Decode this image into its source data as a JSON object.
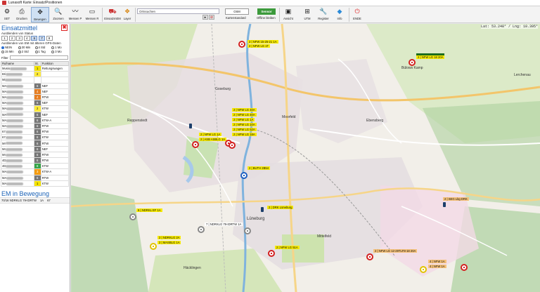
{
  "window": {
    "title": "Lunasoft Karte: Einsatz/Positionen"
  },
  "ribbon": {
    "buttons": [
      {
        "label": "SET",
        "icon": "gear-icon"
      },
      {
        "label": "Drucken",
        "icon": "printer-icon"
      },
      {
        "label": "Bewegen",
        "icon": "move-icon"
      },
      {
        "label": "Zoomen",
        "icon": "zoom-icon"
      },
      {
        "label": "Messen P",
        "icon": "measure-line-icon"
      },
      {
        "label": "Messen R",
        "icon": "measure-area-icon"
      },
      {
        "label": "EinsatzmEM",
        "icon": "units-icon"
      },
      {
        "label": "Layer",
        "icon": "layers-icon"
      },
      {
        "label": "Kartenstandard",
        "icon": "map-icon"
      },
      {
        "label": "Offline bleiben",
        "icon": "offline-icon"
      },
      {
        "label": "Ansicht",
        "icon": "monitor-icon"
      },
      {
        "label": "UTM",
        "icon": "grid-icon"
      },
      {
        "label": "Register",
        "icon": "wrench-icon"
      },
      {
        "label": "Info",
        "icon": "info-icon"
      },
      {
        "label": "ENDE",
        "icon": "power-icon"
      }
    ],
    "search_value": "Ortssuchen",
    "search_reset": "Rücksetzen",
    "map_source": "OSM",
    "sensor_label": "Sensor"
  },
  "left": {
    "title": "Einsatzmittel",
    "status_label": "Ausblenden von Status",
    "status_boxes": [
      "1",
      "2",
      "3",
      "4",
      "6",
      "7",
      "8"
    ],
    "gps_label": "Ausblenden von EM mit älteren GPS-Daten",
    "gps_options": [
      "NEIN",
      "30 Min",
      "4 Std",
      "1 Mo",
      "15 Min",
      "2 Std",
      "1 Tag",
      "3 Mo"
    ],
    "filter_label": "Filter",
    "table_headers": [
      "Rufname",
      "St.",
      "Funktion"
    ],
    "units": [
      {
        "name": "Musio",
        "st": "1",
        "fn": "Rettungswagen",
        "cls": "st-1"
      },
      {
        "name": "Bri",
        "st": "2",
        "fn": "",
        "cls": "st-2"
      },
      {
        "name": "Mi",
        "st": "",
        "fn": "",
        "cls": ""
      },
      {
        "name": "MA",
        "st": "6",
        "fn": "NEF",
        "cls": "st-6"
      },
      {
        "name": "MA",
        "st": "4",
        "fn": "NEF",
        "cls": "st-4"
      },
      {
        "name": "MA",
        "st": "4",
        "fn": "RTW",
        "cls": "st-4"
      },
      {
        "name": "MA",
        "st": "6",
        "fn": "NEF",
        "cls": "st-6"
      },
      {
        "name": "MA",
        "st": "2",
        "fn": "KTW",
        "cls": "st-2"
      },
      {
        "name": "MA",
        "st": "6",
        "fn": "NEF",
        "cls": "st-6"
      },
      {
        "name": "MA",
        "st": "6",
        "fn": "KTW-A",
        "cls": "st-6"
      },
      {
        "name": "MA",
        "st": "6",
        "fn": "RTW",
        "cls": "st-6"
      },
      {
        "name": "67",
        "st": "6",
        "fn": "RTW",
        "cls": "st-6"
      },
      {
        "name": "67",
        "st": "6",
        "fn": "KTW",
        "cls": "st-6"
      },
      {
        "name": "MI",
        "st": "6",
        "fn": "RTW",
        "cls": "st-6"
      },
      {
        "name": "MI",
        "st": "6",
        "fn": "NEF",
        "cls": "st-6"
      },
      {
        "name": "MI",
        "st": "6",
        "fn": "RTW",
        "cls": "st-6"
      },
      {
        "name": "4D",
        "st": "6",
        "fn": "RTW",
        "cls": "st-6"
      },
      {
        "name": "4D",
        "st": "8",
        "fn": "KTW",
        "cls": "st-8"
      },
      {
        "name": "MA",
        "st": "3",
        "fn": "KTW-A",
        "cls": "st-3"
      },
      {
        "name": "MA",
        "st": "6",
        "fn": "RTW",
        "cls": "st-6"
      },
      {
        "name": "MA",
        "st": "1",
        "fn": "KTW",
        "cls": "st-1"
      }
    ],
    "em_title": "EM in Bewegung",
    "em_row": {
      "name": "70/16 NDRKLG 79-IDRTW",
      "a": "1A",
      "b": "67"
    }
  },
  "map": {
    "coords": "Lat: 53.248° / Lng: 10.395°",
    "labels": [
      {
        "text": "2 | NFW 15-25-21 1A",
        "cls": ""
      },
      {
        "text": "2 | NFW LG 1T",
        "cls": ""
      },
      {
        "text": "2 | NFW LG 18 20A",
        "cls": "greenbar"
      },
      {
        "text": "2 | NFW LG 40A",
        "cls": ""
      },
      {
        "text": "2 | NFW LG 40A",
        "cls": ""
      },
      {
        "text": "2 | NFW LG 1A",
        "cls": ""
      },
      {
        "text": "2 | NFW LG 10A",
        "cls": ""
      },
      {
        "text": "2 | NFW LG 52A",
        "cls": ""
      },
      {
        "text": "2 | NFW LG 1A",
        "cls": ""
      },
      {
        "text": "2 | NFW LG 18A",
        "cls": ""
      },
      {
        "text": "2 | ASB ASBLG 1A",
        "cls": ""
      },
      {
        "text": "2 | BUTH 2B54",
        "cls": ""
      },
      {
        "text": "2 | SEG Lbg DRK",
        "cls": "orange"
      },
      {
        "text": "2 | DRK Lüneburg",
        "cls": ""
      },
      {
        "text": "6 | NDRKL EF 1A",
        "cls": ""
      },
      {
        "text": "7 | NDRKLG 79-IDRTW 1A",
        "cls": ""
      },
      {
        "text": "2 | NDRKLG 2A",
        "cls": ""
      },
      {
        "text": "2 | MASBLG 1A",
        "cls": ""
      },
      {
        "text": "2 | NFW LG 51A",
        "cls": ""
      },
      {
        "text": "2 | NFW LG 12-29TLF8-18 20A",
        "cls": "orange"
      },
      {
        "text": "4 | NFW 1A",
        "cls": "orange"
      },
      {
        "text": "4 | NFW 1A",
        "cls": "orange"
      }
    ],
    "towns": [
      "Lüneburg",
      "Ebensberg",
      "Reppenstedt",
      "Häcklingen",
      "Mittelfeld",
      "Moorfeld",
      "Goseburg",
      "Bülows Kamp",
      "Lerchenau"
    ]
  }
}
